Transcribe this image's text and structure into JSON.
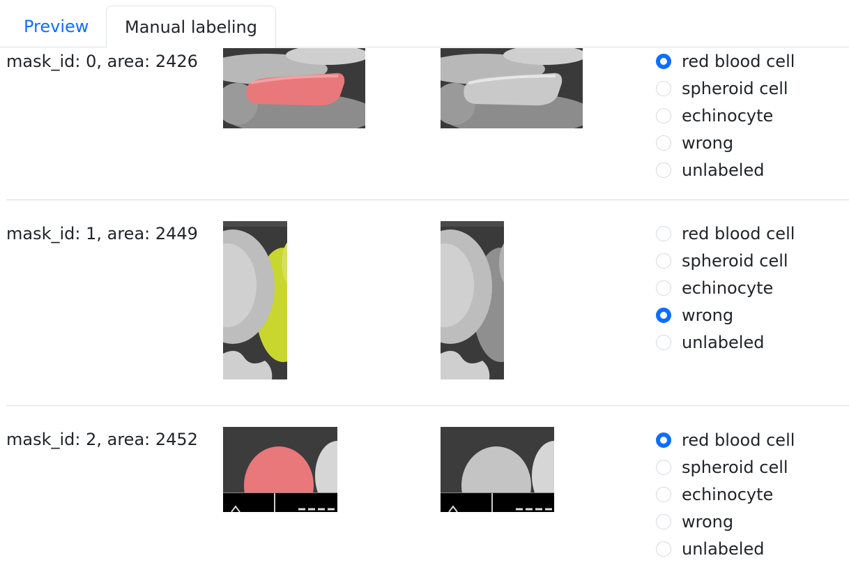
{
  "tabs": {
    "preview": "Preview",
    "manual": "Manual labeling"
  },
  "accent_color": "#0d6efd",
  "rows": [
    {
      "label": "mask_id: 0, area: 2426",
      "mask_color": "#e9787a",
      "options": [
        "red blood cell",
        "spheroid cell",
        "echinocyte",
        "wrong",
        "unlabeled"
      ],
      "selected": "red blood cell"
    },
    {
      "label": "mask_id: 1, area: 2449",
      "mask_color": "#c8d62e",
      "options": [
        "red blood cell",
        "spheroid cell",
        "echinocyte",
        "wrong",
        "unlabeled"
      ],
      "selected": "wrong"
    },
    {
      "label": "mask_id: 2, area: 2452",
      "mask_color": "#e9787a",
      "options": [
        "red blood cell",
        "spheroid cell",
        "echinocyte",
        "wrong",
        "unlabeled"
      ],
      "selected": "red blood cell"
    }
  ]
}
